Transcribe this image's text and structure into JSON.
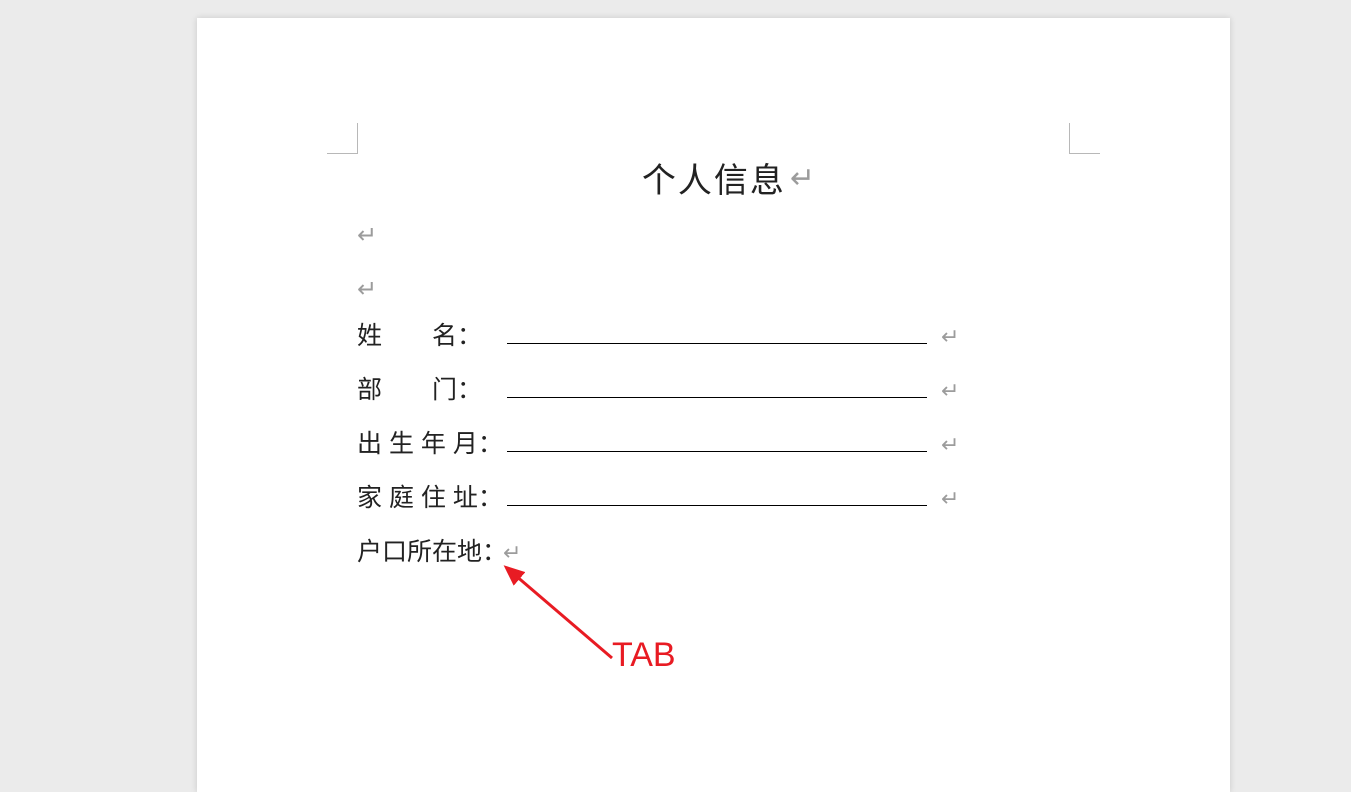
{
  "document": {
    "title": "个人信息",
    "paragraph_mark": "↵",
    "fields": [
      {
        "label": "姓　　名：",
        "underlined": true
      },
      {
        "label": "部　　门：",
        "underlined": true
      },
      {
        "label": "出 生 年 月：",
        "underlined": true
      },
      {
        "label": "家 庭 住 址：",
        "underlined": true
      },
      {
        "label": "户口所在地：",
        "underlined": false
      }
    ]
  },
  "annotation": {
    "label": "TAB",
    "color": "#e81b23"
  }
}
